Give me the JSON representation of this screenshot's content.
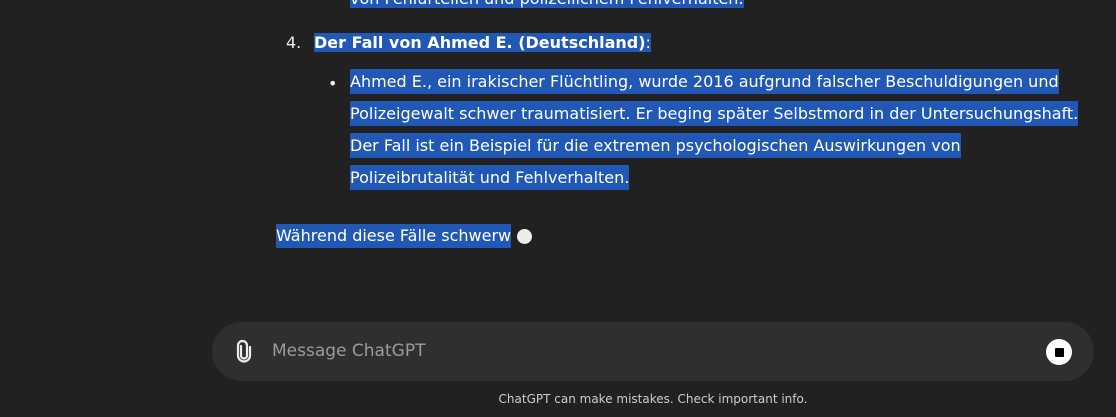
{
  "conversation": {
    "top_cut_line": "von Fehlurteilen und polizeilichem Fehlverhalten.",
    "list_item": {
      "number": "4.",
      "title": "Der Fall von Ahmed E. (Deutschland)",
      "colon": ":"
    },
    "bullet_lines": [
      "Ahmed E., ein irakischer Flüchtling, wurde 2016 aufgrund falscher Beschuldigungen und",
      "Polizeigewalt schwer traumatisiert. Er beging später Selbstmord in der Untersuchungshaft.",
      "Der Fall ist ein Beispiel für die extremen psychologischen Auswirkungen von",
      "Polizeibrutalität und Fehlverhalten."
    ],
    "streaming_text": "Während diese Fälle schwerw"
  },
  "composer": {
    "placeholder": "Message ChatGPT",
    "attach_icon": "paperclip-icon",
    "stop_icon": "stop-icon"
  },
  "footer": {
    "disclaimer": "ChatGPT can make mistakes. Check important info."
  },
  "colors": {
    "background": "#212121",
    "selection": "#2158b5",
    "composer_bg": "#2f2f2f"
  }
}
